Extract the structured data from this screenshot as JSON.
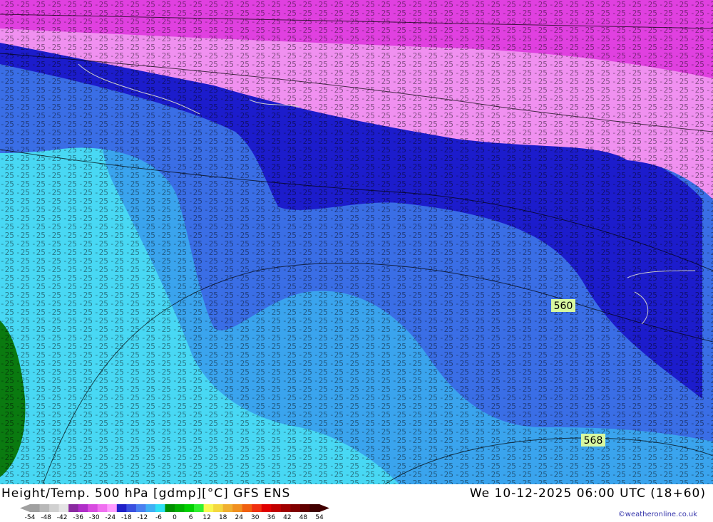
{
  "map": {
    "title": "Height/Temp. 500 hPa [gdmp][°C] GFS ENS",
    "valid_time": "We 10-12-2025 06:00 UTC (18+60)",
    "credit": "©weatheronline.co.uk",
    "contour_labels": [
      {
        "text": "560"
      },
      {
        "text": "568"
      }
    ],
    "legend": {
      "ticks": [
        "-54",
        "-48",
        "-42",
        "-36",
        "-30",
        "-24",
        "-18",
        "-12",
        "-6",
        "0",
        "6",
        "12",
        "18",
        "24",
        "30",
        "36",
        "42",
        "48",
        "54"
      ],
      "colors": [
        "#a0a0a0",
        "#b8b8b8",
        "#d0d0d0",
        "#e4e4e4",
        "#8a2aa0",
        "#b02ec8",
        "#d84ce0",
        "#f070f0",
        "#ff9cff",
        "#2020c8",
        "#3a50e0",
        "#4a80f0",
        "#40b0f4",
        "#30e0f4",
        "#009000",
        "#00b000",
        "#00d000",
        "#30f030",
        "#f8f850",
        "#f4d840",
        "#f0b030",
        "#f09020",
        "#f06010",
        "#f03010",
        "#e00000",
        "#c00000",
        "#a00000",
        "#800000",
        "#600000",
        "#400000"
      ]
    }
  }
}
